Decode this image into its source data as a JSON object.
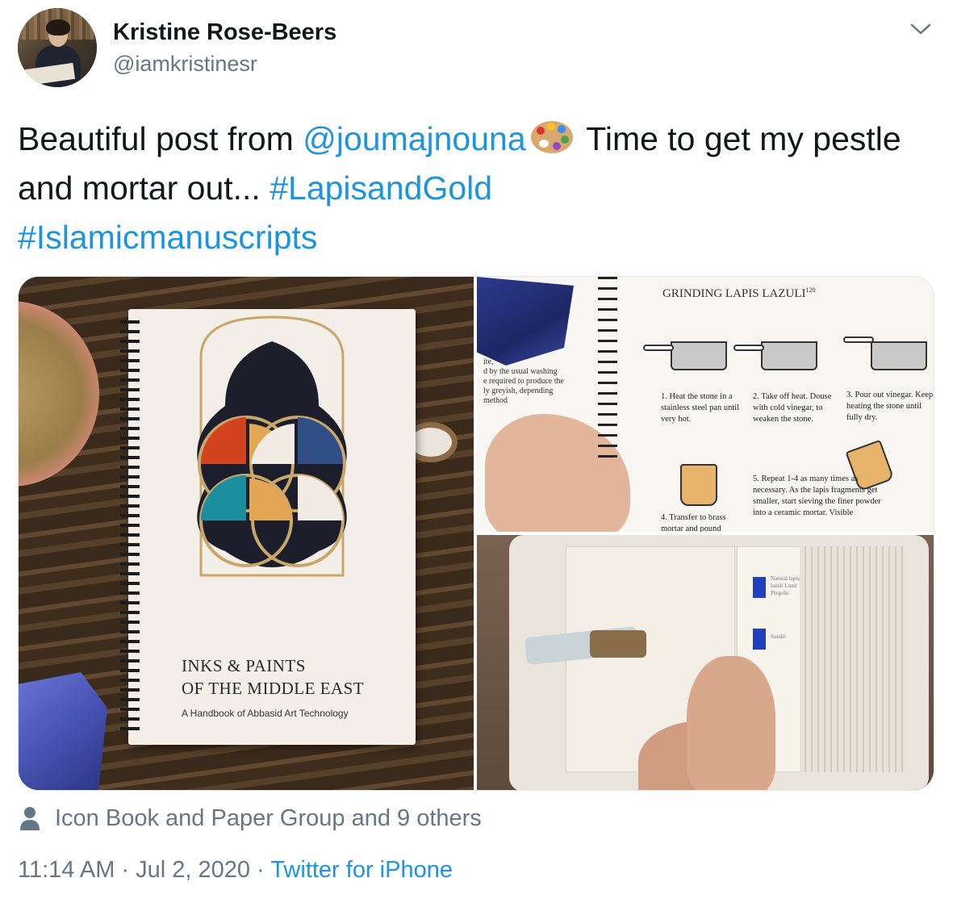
{
  "user": {
    "name": "Kristine Rose-Beers",
    "handle": "@iamkristinesr"
  },
  "tweet": {
    "text_before_mention": "Beautiful post from ",
    "mention": "@joumajnouna",
    "emoji": "palette-emoji",
    "text_after_emoji": " Time to get my pestle and mortar out... ",
    "hashtag1": "#LapisandGold",
    "hashtag2": "#Islamicmanuscripts"
  },
  "media": {
    "left": {
      "book_title_line1": "INKS & PAINTS",
      "book_title_line2": "OF THE MIDDLE EAST",
      "book_subtitle": "A Handbook of Abbasid Art Technology"
    },
    "top_right": {
      "heading": "GRINDING LAPIS LAZULI",
      "heading_sup": "120",
      "left_page_text": "ite,\nd by the usual washing\ne required to produce the\nly greyish, depending\nmethod",
      "step1": "1. Heat the stone in a stainless steel pan until very hot.",
      "step2": "2. Take off heat. Douse with cold vinegar, to weaken the stone.",
      "step3": "3. Pour out vinegar. Keep heating the stone until fully dry.",
      "step4": "4. Transfer to brass mortar and pound",
      "step5": "5. Repeat 1-4 as many times as necessary. As the lapis fragments get smaller, start sieving the finer powder into a ceramic mortar. Visible"
    },
    "bottom_right": {
      "swatch_label1": "Natural lapis lazuli Lund Pergolis",
      "swatch_label2": "Sundit"
    }
  },
  "engagement": {
    "liked_by": "Icon Book and Paper Group and 9 others"
  },
  "meta": {
    "time": "11:14 AM",
    "separator": " · ",
    "date": "Jul 2, 2020",
    "source": "Twitter for iPhone"
  },
  "colors": {
    "link": "#1b95e0",
    "secondary_text": "#657786",
    "primary_text": "#14171a"
  },
  "icons": [
    "caret-down-icon",
    "person-icon",
    "palette-emoji"
  ]
}
